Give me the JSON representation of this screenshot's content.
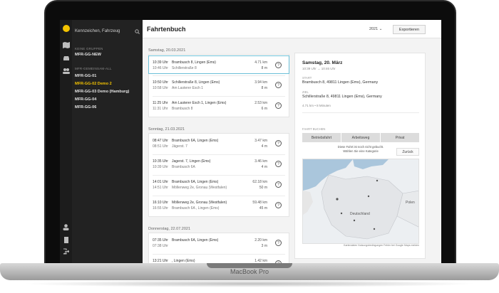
{
  "device_label": "MacBook Pro",
  "sidebar": {
    "search_placeholder": "Kennzeichen, Fahrzeug",
    "section_groups": "KEINE GRUPPEN",
    "section_second": "MFR-GEMEINSAM-ALL",
    "items": [
      {
        "label": "MFR-GG-NEW",
        "active": false
      },
      {
        "label": "MFR-GG-01",
        "active": false
      },
      {
        "label": "MFR-GG-02 Demo 2",
        "active": true
      },
      {
        "label": "MFR-GG-03 Demo (Hamburg)",
        "active": false
      },
      {
        "label": "MFR-GG-04",
        "active": false
      },
      {
        "label": "MFR-GG-06",
        "active": false
      }
    ]
  },
  "header": {
    "title": "Fahrtenbuch",
    "year": "2021",
    "export_label": "Exportieren"
  },
  "days": [
    {
      "label": "Samstag, 20.03.2021",
      "trips": [
        {
          "t1": "10:39 Uhr",
          "t2": "10:46 Uhr",
          "a1": "Brambusch 8, Lingen (Ems)",
          "a2": "Schillerstraße 8",
          "km": "4.71 km",
          "min": "8 m",
          "selected": true
        },
        {
          "t1": "10:50 Uhr",
          "t2": "10:58 Uhr",
          "a1": "Schillerstraße 8, Lingen (Ems)",
          "a2": "Am Lasterer Esch 1",
          "km": "3.94 km",
          "min": "8 m",
          "selected": false
        },
        {
          "t1": "11:25 Uhr",
          "t2": "11:31 Uhr",
          "a1": "Am Lasterer Esch 1, Lingen (Ems)",
          "a2": "Brambusch 8",
          "km": "2.53 km",
          "min": "6 m",
          "selected": false
        }
      ]
    },
    {
      "label": "Sonntag, 21.03.2021",
      "trips": [
        {
          "t1": "08:47 Uhr",
          "t2": "08:51 Uhr",
          "a1": "Brambusch 6A, Lingen (Ems)",
          "a2": "Jägerst. 7",
          "km": "3.47 km",
          "min": "4 m",
          "selected": false
        },
        {
          "t1": "10:35 Uhr",
          "t2": "10:39 Uhr",
          "a1": "Jagerst. 7, Lingen (Ems)",
          "a2": "Brambusch 6A",
          "km": "3.46 km",
          "min": "4 m",
          "selected": false
        },
        {
          "t1": "14:01 Uhr",
          "t2": "14:51 Uhr",
          "a1": "Brambusch 6A, Lingen (Ems)",
          "a2": "Möllenweg 2e, Gronau (Westfalen)",
          "km": "62.18 km",
          "min": "50 m",
          "selected": false
        },
        {
          "t1": "16:10 Uhr",
          "t2": "16:55 Uhr",
          "a1": "Möllenweg 2e, Gronau (Westfalen)",
          "a2": "Brambusch 6A , Lingen (Ems)",
          "km": "59.48 km",
          "min": "45 m",
          "selected": false
        }
      ]
    },
    {
      "label": "Donnerstag, 22.07.2021",
      "trips": [
        {
          "t1": "07:35 Uhr",
          "t2": "07:38 Uhr",
          "a1": "Brambusch 6A, Lingen (Ems)",
          "a2": "",
          "km": "2.20 km",
          "min": "3 m",
          "selected": false
        },
        {
          "t1": "13:21 Uhr",
          "t2": "13:24 Uhr",
          "a1": ", Lingen (Ems)",
          "a2": "Brambusch 6A",
          "km": "1.42 km",
          "min": "3 m",
          "selected": false
        }
      ]
    }
  ],
  "detail": {
    "date": "Samstag, 20. März",
    "time": "10:39 Uhr → 10:46 Uhr",
    "start_label": "START",
    "start": "Brambusch 8, 49811 Lingen (Ems), Germany",
    "end_label": "ZIEL",
    "end": "Schillerstraße 8, 49811 Lingen (Ems), Germany",
    "stats": "4.71 km  •  8 Minuten",
    "category_label": "FAHRT BUCHEN",
    "categories": [
      "Betriebsfahrt",
      "Arbeitsweg",
      "Privat"
    ],
    "note1": "Diese Fahrt ist noch nicht gebucht.",
    "note2": "Wählen Sie eine Kategorie",
    "back_label": "Zurück",
    "map_labels": [
      "Deutschland",
      "Polen"
    ],
    "map_footer": "Kartendaten  Nutzungsbedingungen  Fehler bei Google Maps melden"
  }
}
